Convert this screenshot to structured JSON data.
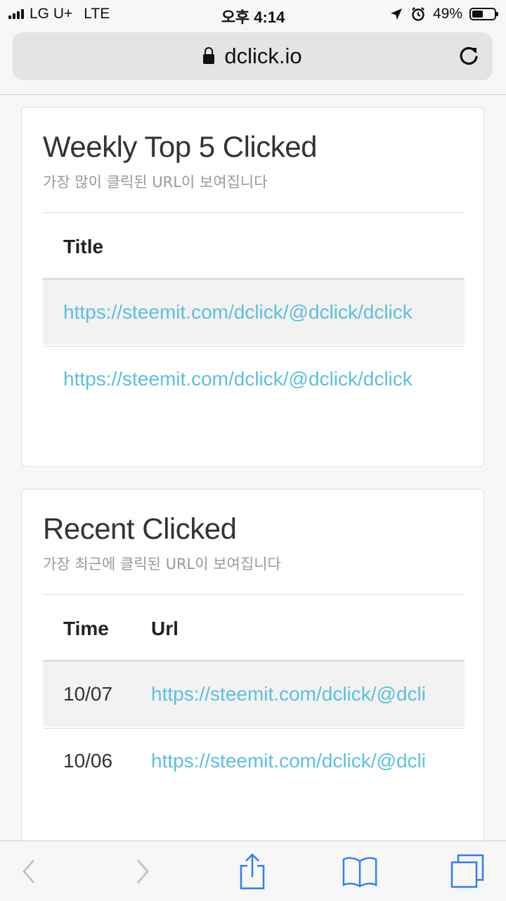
{
  "status_bar": {
    "carrier": "LG U+",
    "network": "LTE",
    "time": "오후 4:14",
    "battery": "49%",
    "battery_level": 0.49
  },
  "browser": {
    "url": "dclick.io",
    "icons": [
      "lock-icon",
      "reload-icon",
      "back-icon",
      "forward-icon",
      "share-icon",
      "bookmarks-icon",
      "tabs-icon"
    ]
  },
  "weekly": {
    "title": "Weekly Top 5 Clicked",
    "subtitle": "가장 많이 클릭된 URL이 보여집니다",
    "header_title": "Title",
    "rows": [
      {
        "url": "https://steemit.com/dclick/@dclick/dclick"
      },
      {
        "url": "https://steemit.com/dclick/@dclick/dclick"
      }
    ]
  },
  "recent": {
    "title": "Recent Clicked",
    "subtitle": "가장 최근에 클릭된 URL이 보여집니다",
    "header_time": "Time",
    "header_url": "Url",
    "rows": [
      {
        "time": "10/07",
        "url": "https://steemit.com/dclick/@dcli"
      },
      {
        "time": "10/06",
        "url": "https://steemit.com/dclick/@dcli"
      }
    ]
  },
  "colors": {
    "link": "#5bc0de",
    "ios_blue": "#2f7cf6"
  }
}
